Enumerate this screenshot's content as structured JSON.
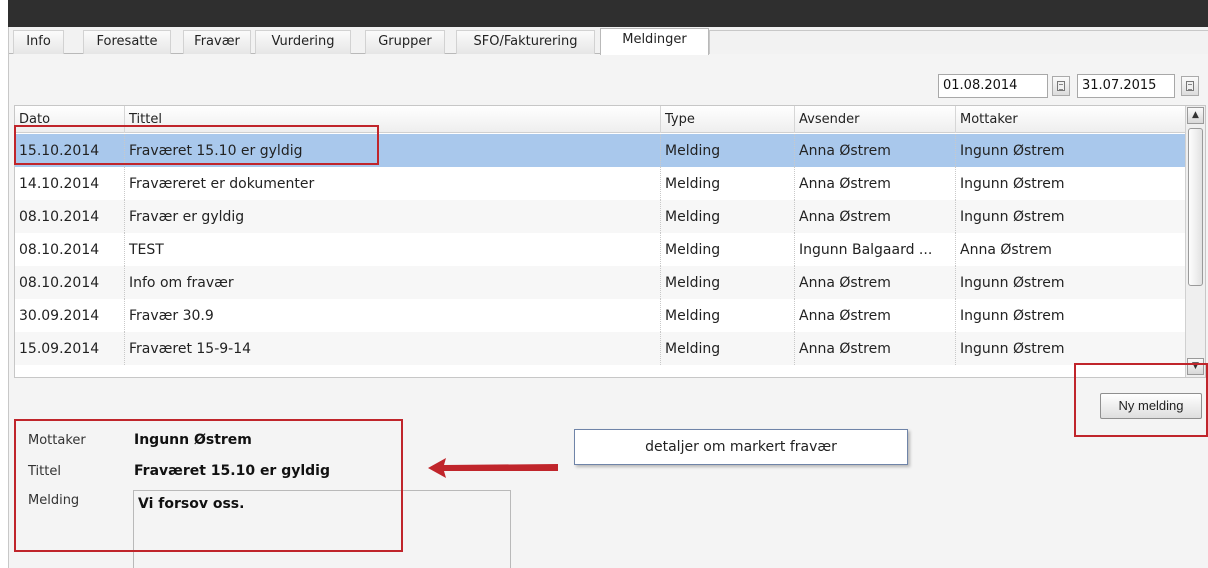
{
  "tabs": [
    "Info",
    "Foresatte",
    "Fravær",
    "Vurdering",
    "Grupper",
    "SFO/Fakturering",
    "Meldinger"
  ],
  "active_tab": "Meldinger",
  "date_range": {
    "from": "01.08.2014",
    "to": "31.07.2015"
  },
  "grid": {
    "columns": [
      "Dato",
      "Tittel",
      "Type",
      "Avsender",
      "Mottaker"
    ],
    "rows": [
      [
        "15.10.2014",
        "Fraværet 15.10 er gyldig",
        "Melding",
        "Anna Østrem",
        "Ingunn Østrem"
      ],
      [
        "14.10.2014",
        "Fraværeret er dokumenter",
        "Melding",
        "Anna Østrem",
        "Ingunn Østrem"
      ],
      [
        "08.10.2014",
        "Fravær er gyldig",
        "Melding",
        "Anna Østrem",
        "Ingunn Østrem"
      ],
      [
        "08.10.2014",
        "TEST",
        "Melding",
        "Ingunn Balgaard ...",
        "Anna Østrem"
      ],
      [
        "08.10.2014",
        "Info om fravær",
        "Melding",
        "Anna Østrem",
        "Ingunn Østrem"
      ],
      [
        "30.09.2014",
        "Fravær 30.9",
        "Melding",
        "Anna Østrem",
        "Ingunn Østrem"
      ],
      [
        "15.09.2014",
        "Fraværet 15-9-14",
        "Melding",
        "Anna Østrem",
        "Ingunn Østrem"
      ]
    ],
    "selected_row": 0
  },
  "new_message_button": "Ny melding",
  "details": {
    "recipient_label": "Mottaker",
    "recipient": "Ingunn Østrem",
    "title_label": "Tittel",
    "title": "Fraværet 15.10 er gyldig",
    "message_label": "Melding",
    "message": "Vi forsov oss."
  },
  "annotation": {
    "callout_text": "detaljer om markert fravær",
    "highlight_color": "#c0252b"
  },
  "icons": {
    "date_picker": "calendar-icon",
    "scroll_up": "arrow-up-icon",
    "scroll_down": "arrow-down-icon"
  }
}
